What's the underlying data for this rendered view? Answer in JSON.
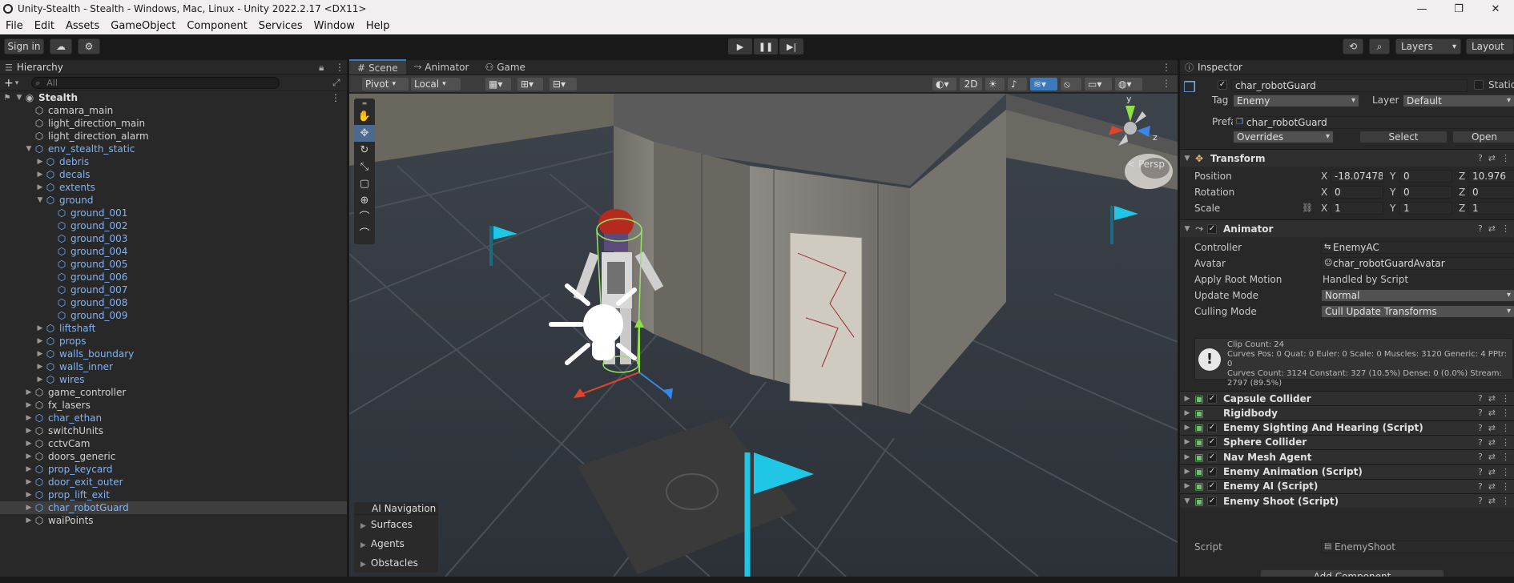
{
  "window": {
    "title": "Unity-Stealth - Stealth - Windows, Mac, Linux - Unity 2022.2.17 <DX11>",
    "controls": [
      "—",
      "❐",
      "✕"
    ]
  },
  "menu": [
    "File",
    "Edit",
    "Assets",
    "GameObject",
    "Component",
    "Services",
    "Window",
    "Help"
  ],
  "toolbar": {
    "sign_in": "Sign in",
    "layers": "Layers",
    "layout": "Layout"
  },
  "hierarchy": {
    "tab": "Hierarchy",
    "search_placeholder": "All",
    "scene": "Stealth",
    "items": [
      {
        "label": "camara_main",
        "depth": 1,
        "arrow": "",
        "blue": false
      },
      {
        "label": "light_direction_main",
        "depth": 1,
        "arrow": "",
        "blue": false
      },
      {
        "label": "light_direction_alarm",
        "depth": 1,
        "arrow": "",
        "blue": false
      },
      {
        "label": "env_stealth_static",
        "depth": 1,
        "arrow": "▼",
        "blue": true
      },
      {
        "label": "debris",
        "depth": 2,
        "arrow": "▶",
        "blue": true
      },
      {
        "label": "decals",
        "depth": 2,
        "arrow": "▶",
        "blue": true
      },
      {
        "label": "extents",
        "depth": 2,
        "arrow": "▶",
        "blue": true
      },
      {
        "label": "ground",
        "depth": 2,
        "arrow": "▼",
        "blue": true
      },
      {
        "label": "ground_001",
        "depth": 3,
        "arrow": "",
        "blue": true
      },
      {
        "label": "ground_002",
        "depth": 3,
        "arrow": "",
        "blue": true
      },
      {
        "label": "ground_003",
        "depth": 3,
        "arrow": "",
        "blue": true
      },
      {
        "label": "ground_004",
        "depth": 3,
        "arrow": "",
        "blue": true
      },
      {
        "label": "ground_005",
        "depth": 3,
        "arrow": "",
        "blue": true
      },
      {
        "label": "ground_006",
        "depth": 3,
        "arrow": "",
        "blue": true
      },
      {
        "label": "ground_007",
        "depth": 3,
        "arrow": "",
        "blue": true
      },
      {
        "label": "ground_008",
        "depth": 3,
        "arrow": "",
        "blue": true
      },
      {
        "label": "ground_009",
        "depth": 3,
        "arrow": "",
        "blue": true
      },
      {
        "label": "liftshaft",
        "depth": 2,
        "arrow": "▶",
        "blue": true
      },
      {
        "label": "props",
        "depth": 2,
        "arrow": "▶",
        "blue": true
      },
      {
        "label": "walls_boundary",
        "depth": 2,
        "arrow": "▶",
        "blue": true
      },
      {
        "label": "walls_inner",
        "depth": 2,
        "arrow": "▶",
        "blue": true
      },
      {
        "label": "wires",
        "depth": 2,
        "arrow": "▶",
        "blue": true
      },
      {
        "label": "game_controller",
        "depth": 1,
        "arrow": "▶",
        "blue": false
      },
      {
        "label": "fx_lasers",
        "depth": 1,
        "arrow": "▶",
        "blue": false
      },
      {
        "label": "char_ethan",
        "depth": 1,
        "arrow": "▶",
        "blue": true
      },
      {
        "label": "switchUnits",
        "depth": 1,
        "arrow": "▶",
        "blue": false
      },
      {
        "label": "cctvCam",
        "depth": 1,
        "arrow": "▶",
        "blue": false
      },
      {
        "label": "doors_generic",
        "depth": 1,
        "arrow": "▶",
        "blue": false
      },
      {
        "label": "prop_keycard",
        "depth": 1,
        "arrow": "▶",
        "blue": true
      },
      {
        "label": "door_exit_outer",
        "depth": 1,
        "arrow": "▶",
        "blue": true
      },
      {
        "label": "prop_lift_exit",
        "depth": 1,
        "arrow": "▶",
        "blue": true
      },
      {
        "label": "char_robotGuard",
        "depth": 1,
        "arrow": "▶",
        "blue": true,
        "selected": true
      },
      {
        "label": "waiPoints",
        "depth": 1,
        "arrow": "▶",
        "blue": false
      }
    ]
  },
  "scene_view": {
    "tabs": [
      "Scene",
      "Animator",
      "Game"
    ],
    "pivot": "Pivot",
    "local": "Local",
    "mode_2d": "2D",
    "persp": "< Persp",
    "gizmo_y": "y",
    "gizmo_z": "z",
    "ai_nav": {
      "title": "AI Navigation",
      "items": [
        "Surfaces",
        "Agents",
        "Obstacles"
      ]
    }
  },
  "inspector": {
    "tab": "Inspector",
    "object_name": "char_robotGuard",
    "static_label": "Static",
    "tag_label": "Tag",
    "tag_value": "Enemy",
    "layer_label": "Layer",
    "layer_value": "Default",
    "prefab_label": "Prefab",
    "prefab_value": "char_robotGuard",
    "overrides": "Overrides",
    "select": "Select",
    "open": "Open",
    "transform": {
      "title": "Transform",
      "position_label": "Position",
      "rotation_label": "Rotation",
      "scale_label": "Scale",
      "position": {
        "x": "-18.07478",
        "y": "0",
        "z": "10.976"
      },
      "rotation": {
        "x": "0",
        "y": "0",
        "z": "0"
      },
      "scale": {
        "x": "1",
        "y": "1",
        "z": "1"
      }
    },
    "animator": {
      "title": "Animator",
      "controller_label": "Controller",
      "controller_value": "EnemyAC",
      "avatar_label": "Avatar",
      "avatar_value": "char_robotGuardAvatar",
      "root_motion_label": "Apply Root Motion",
      "root_motion_value": "Handled by Script",
      "update_mode_label": "Update Mode",
      "update_mode_value": "Normal",
      "culling_label": "Culling Mode",
      "culling_value": "Cull Update Transforms",
      "info": "Clip Count: 24\nCurves Pos: 0 Quat: 0 Euler: 0 Scale: 0 Muscles: 3120 Generic: 4 PPtr: 0\nCurves Count: 3124 Constant: 327 (10.5%) Dense: 0 (0.0%) Stream: 2797 (89.5%)"
    },
    "components": [
      "Capsule Collider",
      "Rigidbody",
      "Enemy Sighting And Hearing (Script)",
      "Sphere Collider",
      "Nav Mesh Agent",
      "Enemy Animation (Script)",
      "Enemy AI (Script)",
      "Enemy Shoot (Script)"
    ],
    "script_label": "Script",
    "script_value": "EnemyShoot",
    "add_component": "Add Component"
  }
}
